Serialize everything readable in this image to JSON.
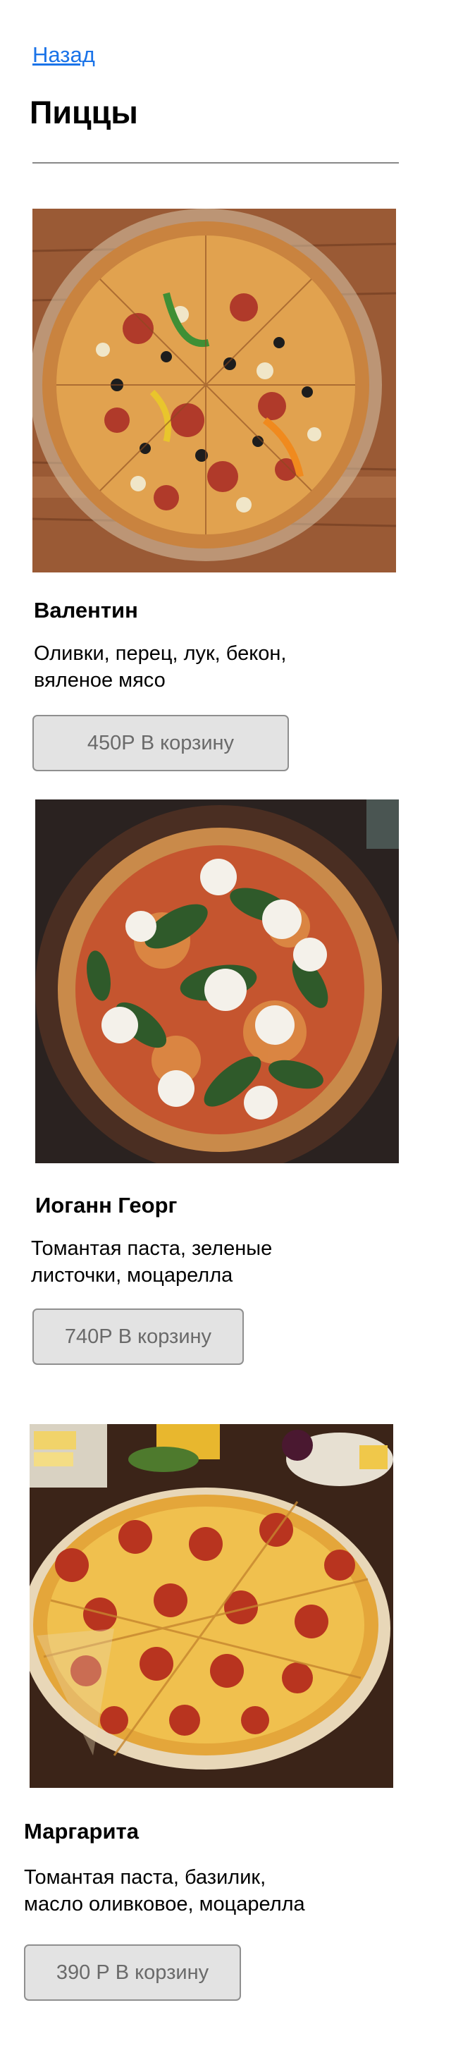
{
  "nav": {
    "back_label": "Назад"
  },
  "page": {
    "title": "Пиццы"
  },
  "pizzas": [
    {
      "name": "Валентин",
      "desc_line1": "Оливки, перец, лук, бекон,",
      "desc_line2": "вяленое мясо",
      "button_label": "450Р В корзину"
    },
    {
      "name": "Иоганн Георг",
      "desc_line1": "Томантая паста, зеленые",
      "desc_line2": "листочки, моцарелла",
      "button_label": "740Р В корзину"
    },
    {
      "name": "Маргарита",
      "desc_line1": "Томантая паста, базилик,",
      "desc_line2": "масло оливковое, моцарелла",
      "button_label": "390 Р В корзину"
    }
  ],
  "colors": {
    "link": "#1a73e8",
    "button_bg": "#e3e3e3",
    "button_border": "#8f8f8f",
    "button_text": "#6a6a6a"
  }
}
